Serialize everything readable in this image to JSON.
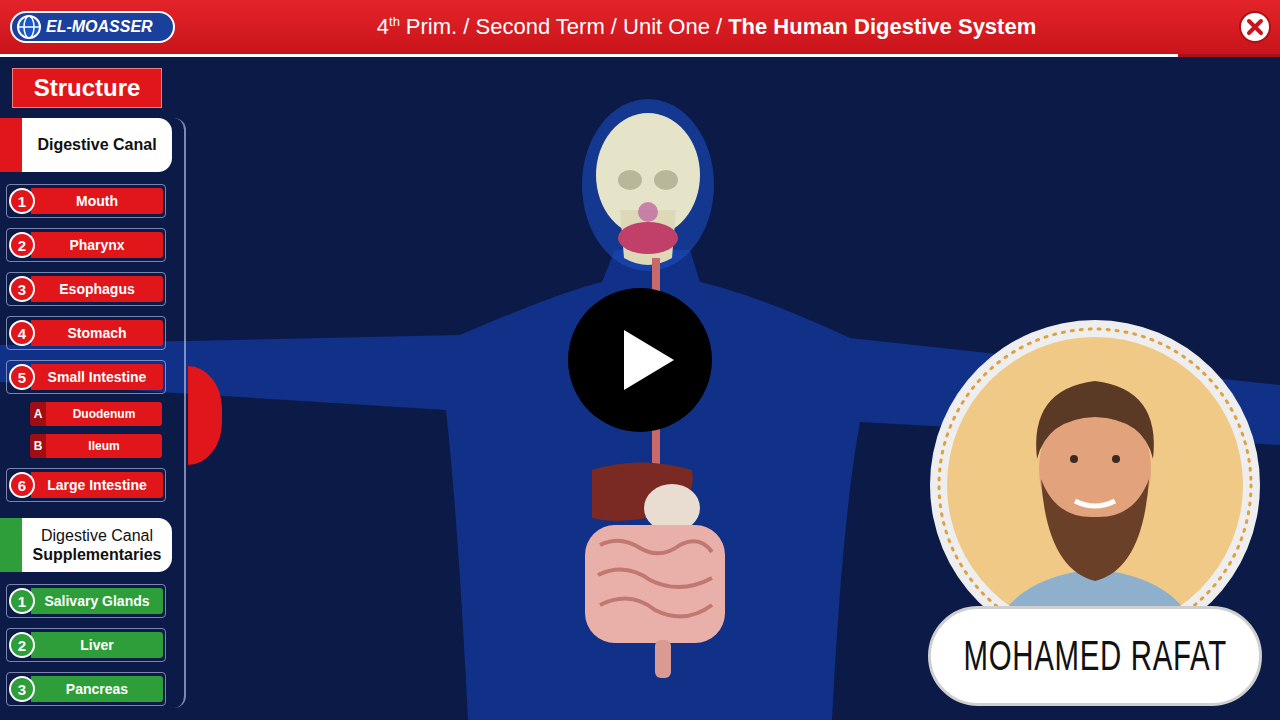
{
  "header": {
    "logo": "EL-MOASSER",
    "grade_number": "4",
    "grade_suffix": "th",
    "path": "Prim. / Second Term / Unit One /",
    "topic": "The Human Digestive System"
  },
  "progress": {
    "level": 0.92
  },
  "sidebar": {
    "heading": "Structure",
    "groups": [
      {
        "title_lines": [
          {
            "text": "Digestive Canal",
            "bold": true
          }
        ],
        "color": "#e0161b",
        "items": [
          {
            "number": "1",
            "label": "Mouth",
            "selected": false,
            "sub": []
          },
          {
            "number": "2",
            "label": "Pharynx",
            "selected": false,
            "sub": []
          },
          {
            "number": "3",
            "label": "Esophagus",
            "selected": false,
            "sub": []
          },
          {
            "number": "4",
            "label": "Stomach",
            "selected": false,
            "sub": []
          },
          {
            "number": "5",
            "label": "Small Intestine",
            "selected": true,
            "sub": [
              {
                "letter": "A",
                "label": "Duodenum"
              },
              {
                "letter": "B",
                "label": "Ileum"
              }
            ]
          },
          {
            "number": "6",
            "label": "Large Intestine",
            "selected": false,
            "sub": []
          }
        ]
      },
      {
        "title_lines": [
          {
            "text": "Digestive Canal",
            "bold": false
          },
          {
            "text": "Supplementaries",
            "bold": true
          }
        ],
        "color": "#2e9e3a",
        "items": [
          {
            "number": "1",
            "label": "Salivary Glands",
            "selected": false,
            "sub": []
          },
          {
            "number": "2",
            "label": "Liver",
            "selected": false,
            "sub": []
          },
          {
            "number": "3",
            "label": "Pancreas",
            "selected": false,
            "sub": []
          }
        ]
      }
    ]
  },
  "player": {
    "playing": false
  },
  "presenter": {
    "name": "MOHAMED RAFAT"
  }
}
